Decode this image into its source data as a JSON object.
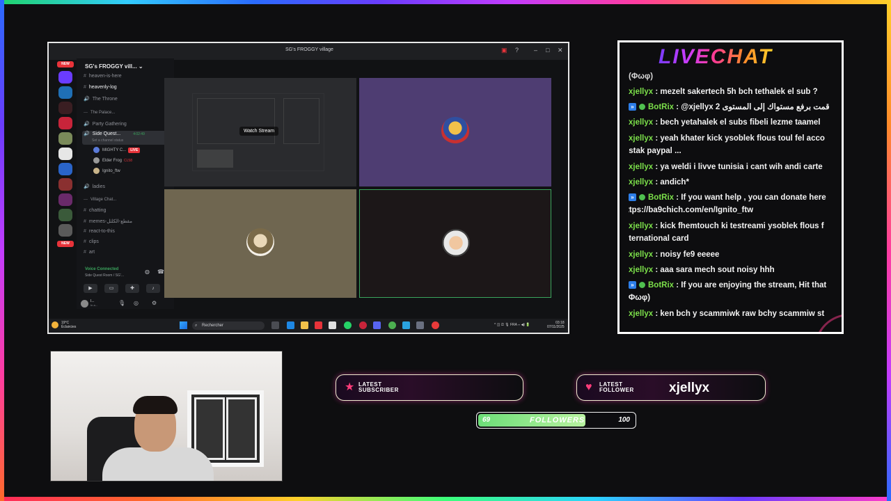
{
  "discord": {
    "window_title": "SG's FROGGY village",
    "server_name": "SG's FROGGY vill...",
    "new_badge": "NEW",
    "channels": [
      {
        "label": "heaven-is-here",
        "type": "text"
      },
      {
        "label": "heavenly-log",
        "type": "text"
      },
      {
        "label": "The Throne",
        "type": "voice"
      },
      {
        "label": "The Palace...",
        "type": "category"
      },
      {
        "label": "Party Gathering",
        "type": "voice"
      },
      {
        "label": "Side Quest...",
        "type": "voice"
      },
      {
        "label": "ladies",
        "type": "voice"
      },
      {
        "label": "Village Chat...",
        "type": "category"
      },
      {
        "label": "chatting",
        "type": "text"
      },
      {
        "label": "memes-مقطع-الكلثل",
        "type": "text"
      },
      {
        "label": "react-to-this",
        "type": "text"
      },
      {
        "label": "clips",
        "type": "text"
      },
      {
        "label": "art",
        "type": "text"
      }
    ],
    "channel_status": "Set a channel status",
    "channel_time": "4:02:49",
    "voice_users": [
      {
        "name": "MIGHTY C...",
        "badge": "LIVE"
      },
      {
        "name": "Elder Frog",
        "badge": "CL58"
      },
      {
        "name": "Ignito_ftw",
        "badge": ""
      }
    ],
    "voice_connected": "Voice Connected",
    "voice_room": "Side Quest Room / SG'...",
    "watch_stream": "Watch Stream",
    "self_user": "I...",
    "self_status": "In a..."
  },
  "taskbar": {
    "weather_temp": "19°C",
    "weather_desc": "Éclaircies",
    "search_placeholder": "Rechercher",
    "lang": "FRA",
    "time": "03:18",
    "date": "07/11/2025"
  },
  "livechat": {
    "title": "LIVECHAT",
    "messages": [
      {
        "user": "",
        "text": "(Φωφ)",
        "bot": false
      },
      {
        "user": "xjellyx",
        "text": ": mezelt sakertech 5h bch tethalek el sub ?",
        "bot": false
      },
      {
        "user": "BotRix",
        "text": ": @xjellyx 2 قمت برفع مستواك إلى المستوى",
        "bot": true
      },
      {
        "user": "xjellyx",
        "text": ": bech yetahalek el subs fibeli lezme taamel",
        "bot": false
      },
      {
        "user": "xjellyx",
        "text": ": yeah khater kick ysoblek flous toul fel acco",
        "cont": "testak paypal ...",
        "bot": false
      },
      {
        "user": "xjellyx",
        "text": ": ya weldi i livve tunisia i cant wih andi carte",
        "bot": false
      },
      {
        "user": "xjellyx",
        "text": ": andich*",
        "bot": false
      },
      {
        "user": "BotRix",
        "text": ": If you want help , you can donate here",
        "cont": "https://ba9chich.com/en/Ignito_ftw",
        "bot": true
      },
      {
        "user": "xjellyx",
        "text": ": kick fhemtouch ki testreami ysoblek flous f",
        "cont": "international card",
        "bot": false
      },
      {
        "user": "xjellyx",
        "text": ": noisy fe9 eeeee",
        "bot": false
      },
      {
        "user": "xjellyx",
        "text": ": aaa sara mech sout noisy hhh",
        "bot": false
      },
      {
        "user": "BotRix",
        "text": ": If you are enjoying the stream, Hit that",
        "cont": "(Φωφ)",
        "bot": true
      },
      {
        "user": "xjellyx",
        "text": ": ken bch y scammiwk raw bchy scammiw st",
        "bot": false
      }
    ]
  },
  "alerts": {
    "subscriber_label_1": "LATEST",
    "subscriber_label_2": "SUBSCRIBER",
    "subscriber_name": "",
    "follower_label_1": "LATEST",
    "follower_label_2": "FOLLOWER",
    "follower_name": "xjellyx"
  },
  "goal": {
    "start": "69",
    "label": "FOLLOWERS",
    "end": "100",
    "progress_fraction": 0.69
  },
  "colors": {
    "chat_username": "#7ce04a",
    "goal_fill": "#6cde78",
    "alert_heart": "#ff3c7a",
    "voice_connected": "#3ba55d"
  }
}
